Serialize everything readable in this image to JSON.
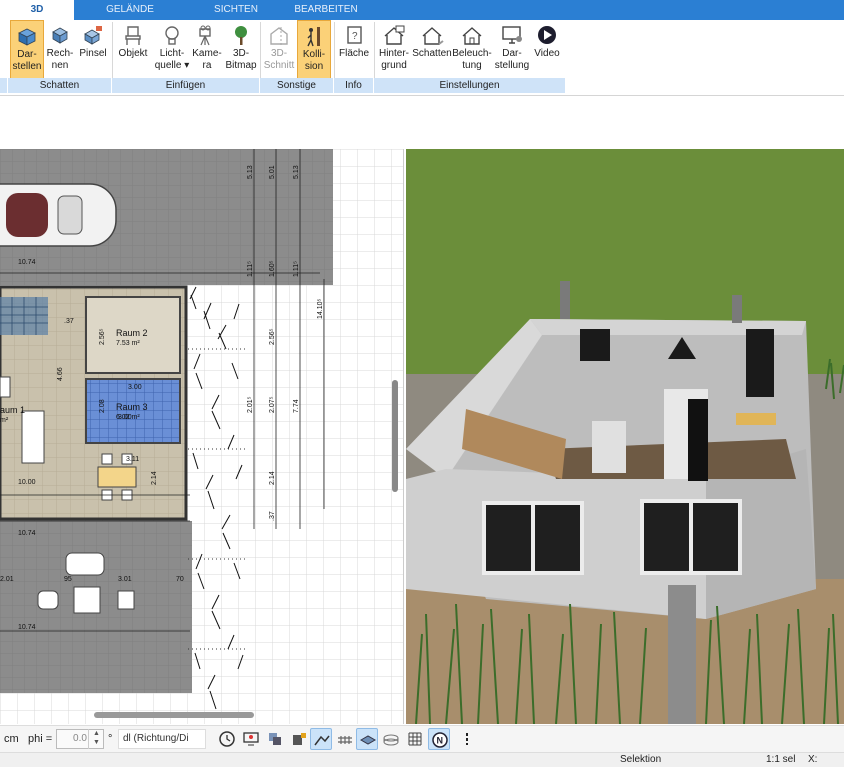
{
  "tabs": [
    {
      "label": "3D",
      "active": true
    },
    {
      "label": "GELÄNDE",
      "active": false
    },
    {
      "label": "SICHTEN",
      "active": false
    },
    {
      "label": "BEARBEITEN",
      "active": false
    }
  ],
  "ribbon": {
    "darstellen": [
      "Dar-",
      "stellen"
    ],
    "rechnen": [
      "Rech-",
      "nen"
    ],
    "pinsel": "Pinsel",
    "objekt": "Objekt",
    "lichtquelle": [
      "Licht-",
      "quelle"
    ],
    "kamera": [
      "Kame-",
      "ra"
    ],
    "bitmap": [
      "3D-",
      "Bitmap"
    ],
    "schnitt": [
      "3D-",
      "Schnitt"
    ],
    "kollision": [
      "Kolli-",
      "sion"
    ],
    "flaeche": "Fläche",
    "hintergrund": [
      "Hinter-",
      "grund"
    ],
    "schatten": "Schatten",
    "beleuchtung": [
      "Beleuch-",
      "tung"
    ],
    "darstellung": [
      "Dar-",
      "stellung"
    ],
    "video": "Video"
  },
  "groups": [
    "Schatten",
    "Einfügen",
    "Sonstige",
    "Info",
    "Einstellungen"
  ],
  "plan": {
    "rooms": [
      {
        "name": "Raum 2",
        "area": "7.53 m²"
      },
      {
        "name": "Raum 3",
        "area": "6.02 m²"
      },
      {
        "name": "aum 1",
        "area": "m²"
      }
    ],
    "dims": [
      "10.74",
      "5.13",
      "5.01",
      "5.13",
      "1.11⁵",
      "1.60⁵",
      "1.11⁵",
      "14.10⁵",
      "2.56⁵",
      "2.56⁵",
      "2.08",
      "2.07⁵",
      "7.74",
      "2.01⁵",
      "2.14",
      "2.14",
      "3.00",
      "3.00",
      "3.11",
      "2.01",
      "3.01",
      "2.01",
      "10.00",
      "10.74",
      "10.74",
      "10.74",
      "4.66",
      ".88⁵",
      ".37",
      "95",
      "70"
    ]
  },
  "toolbar": {
    "unit": "cm",
    "phi_label": "phi =",
    "phi_value": "0.0",
    "degree": "°",
    "direction": "dl (Richtung/Di"
  },
  "status": {
    "mode": "Selektion",
    "scale": "1:1 sel",
    "x": "X:"
  },
  "colors": {
    "tabbar": "#2b7fd3",
    "selected": "#fbd178",
    "group": "#cfe3f8",
    "grass": "#6b8e3a"
  }
}
